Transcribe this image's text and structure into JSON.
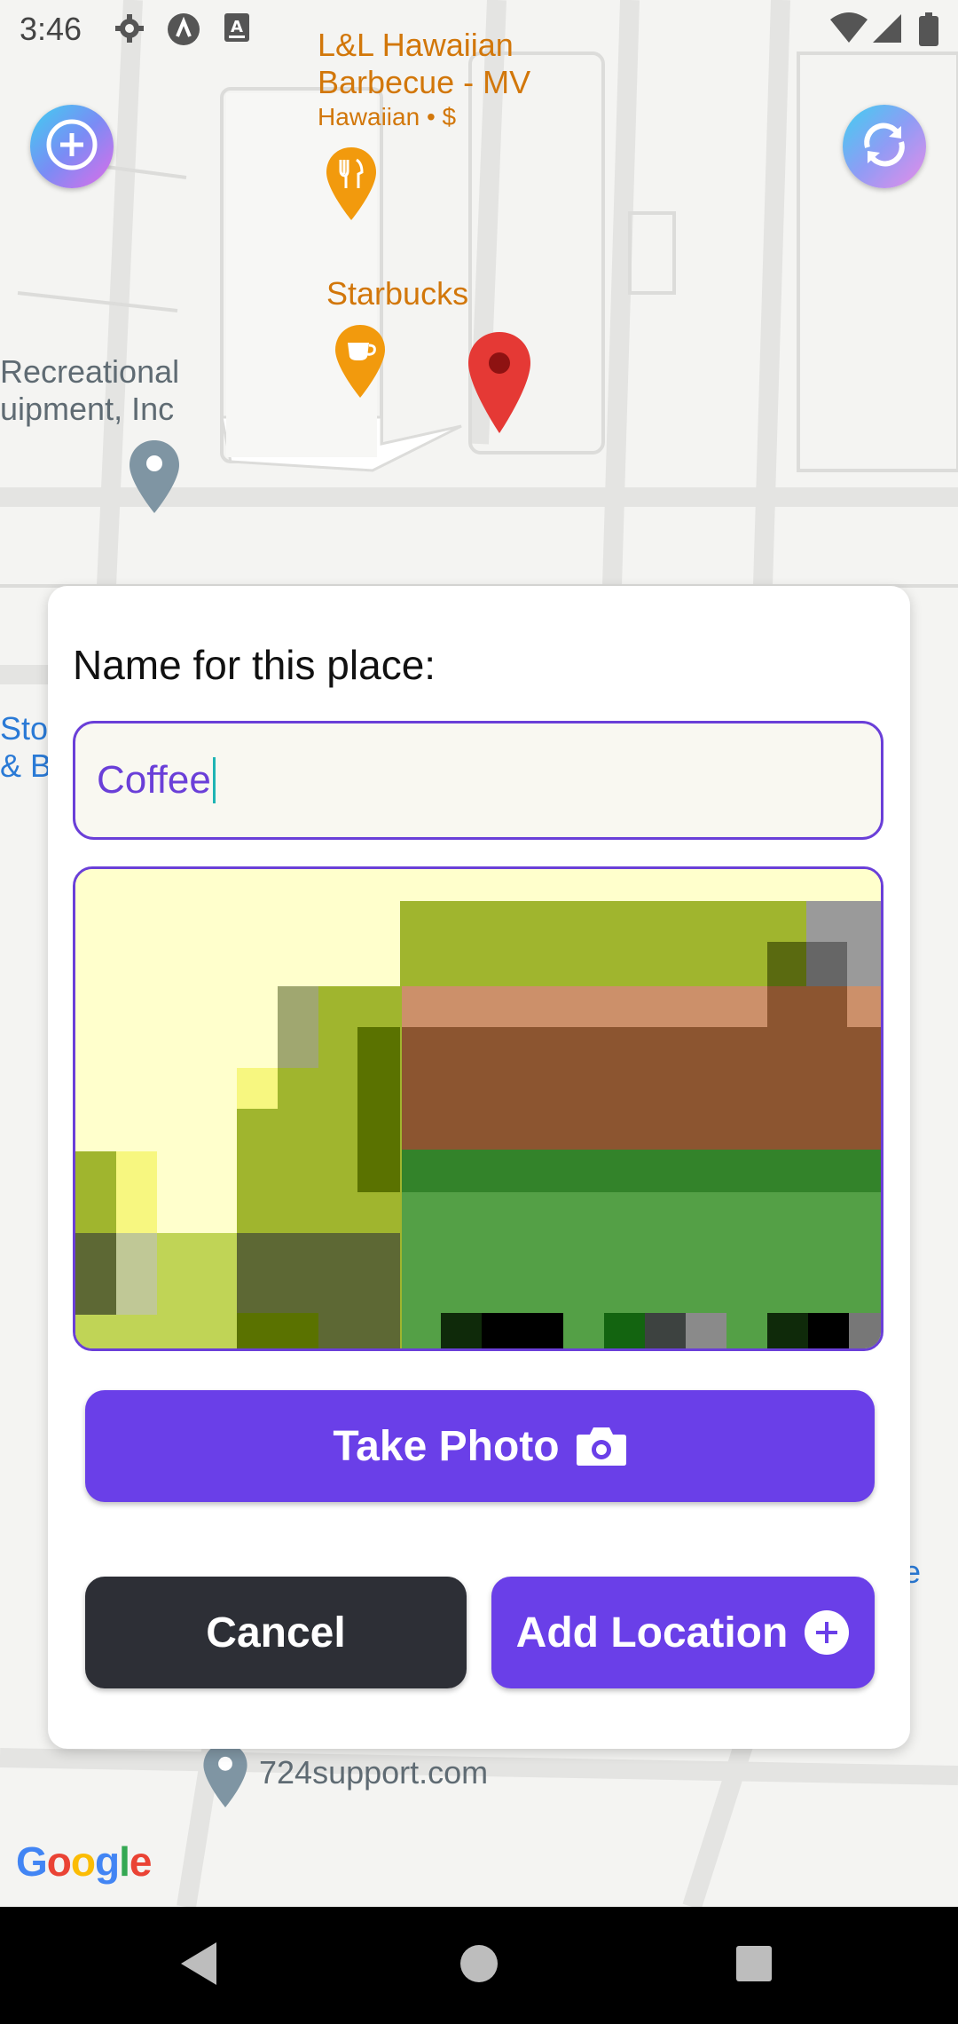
{
  "status_bar": {
    "time": "3:46",
    "left_icons": [
      "gear-icon",
      "a-circle-icon",
      "a-square-icon"
    ],
    "right_icons": [
      "wifi-icon",
      "signal-icon",
      "battery-icon"
    ]
  },
  "map": {
    "pois": [
      {
        "line1": "L&L Hawaiian",
        "line2": "Barbecue - MV",
        "sub": "Hawaiian • $",
        "icon": "restaurant-icon"
      },
      {
        "line1": "Starbucks",
        "icon": "coffee-icon"
      },
      {
        "line1": "Recreational",
        "line2": "uipment, Inc",
        "icon": "place-icon"
      },
      {
        "line1": "Stor",
        "line2": "& B"
      },
      {
        "line1": "724support.com",
        "icon": "place-icon"
      },
      {
        "line1": "re"
      }
    ],
    "google_logo": "Google",
    "colors": {
      "orange": "#d2770a",
      "pin_red": "#e53935"
    }
  },
  "fabs": {
    "add_icon": "add-location-icon",
    "refresh_icon": "refresh-icon"
  },
  "dialog": {
    "title": "Name for this place:",
    "name_value": "Coffee",
    "take_photo_label": "Take Photo",
    "cancel_label": "Cancel",
    "add_location_label": "Add Location",
    "accent": "#6a3fe8"
  },
  "nav_bar": {
    "buttons": [
      "back-icon",
      "home-icon",
      "recents-icon"
    ]
  }
}
